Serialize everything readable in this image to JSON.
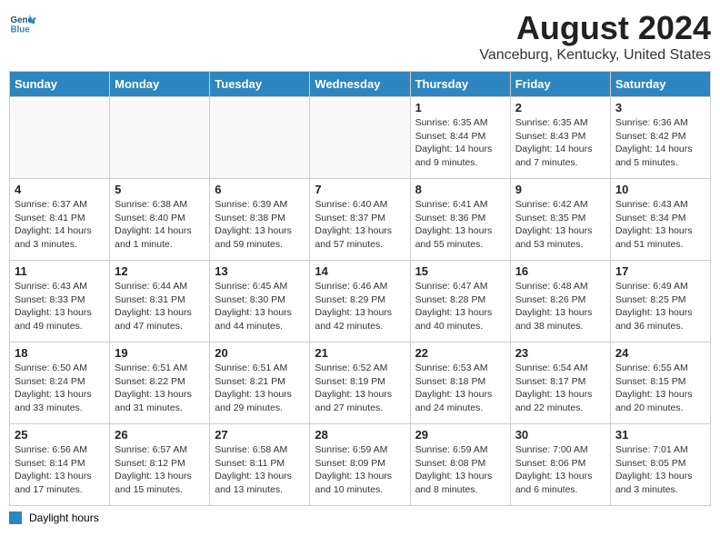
{
  "header": {
    "logo_line1": "General",
    "logo_line2": "Blue",
    "month": "August 2024",
    "location": "Vanceburg, Kentucky, United States"
  },
  "days_of_week": [
    "Sunday",
    "Monday",
    "Tuesday",
    "Wednesday",
    "Thursday",
    "Friday",
    "Saturday"
  ],
  "weeks": [
    [
      {
        "day": "",
        "info": ""
      },
      {
        "day": "",
        "info": ""
      },
      {
        "day": "",
        "info": ""
      },
      {
        "day": "",
        "info": ""
      },
      {
        "day": "1",
        "info": "Sunrise: 6:35 AM\nSunset: 8:44 PM\nDaylight: 14 hours\nand 9 minutes."
      },
      {
        "day": "2",
        "info": "Sunrise: 6:35 AM\nSunset: 8:43 PM\nDaylight: 14 hours\nand 7 minutes."
      },
      {
        "day": "3",
        "info": "Sunrise: 6:36 AM\nSunset: 8:42 PM\nDaylight: 14 hours\nand 5 minutes."
      }
    ],
    [
      {
        "day": "4",
        "info": "Sunrise: 6:37 AM\nSunset: 8:41 PM\nDaylight: 14 hours\nand 3 minutes."
      },
      {
        "day": "5",
        "info": "Sunrise: 6:38 AM\nSunset: 8:40 PM\nDaylight: 14 hours\nand 1 minute."
      },
      {
        "day": "6",
        "info": "Sunrise: 6:39 AM\nSunset: 8:38 PM\nDaylight: 13 hours\nand 59 minutes."
      },
      {
        "day": "7",
        "info": "Sunrise: 6:40 AM\nSunset: 8:37 PM\nDaylight: 13 hours\nand 57 minutes."
      },
      {
        "day": "8",
        "info": "Sunrise: 6:41 AM\nSunset: 8:36 PM\nDaylight: 13 hours\nand 55 minutes."
      },
      {
        "day": "9",
        "info": "Sunrise: 6:42 AM\nSunset: 8:35 PM\nDaylight: 13 hours\nand 53 minutes."
      },
      {
        "day": "10",
        "info": "Sunrise: 6:43 AM\nSunset: 8:34 PM\nDaylight: 13 hours\nand 51 minutes."
      }
    ],
    [
      {
        "day": "11",
        "info": "Sunrise: 6:43 AM\nSunset: 8:33 PM\nDaylight: 13 hours\nand 49 minutes."
      },
      {
        "day": "12",
        "info": "Sunrise: 6:44 AM\nSunset: 8:31 PM\nDaylight: 13 hours\nand 47 minutes."
      },
      {
        "day": "13",
        "info": "Sunrise: 6:45 AM\nSunset: 8:30 PM\nDaylight: 13 hours\nand 44 minutes."
      },
      {
        "day": "14",
        "info": "Sunrise: 6:46 AM\nSunset: 8:29 PM\nDaylight: 13 hours\nand 42 minutes."
      },
      {
        "day": "15",
        "info": "Sunrise: 6:47 AM\nSunset: 8:28 PM\nDaylight: 13 hours\nand 40 minutes."
      },
      {
        "day": "16",
        "info": "Sunrise: 6:48 AM\nSunset: 8:26 PM\nDaylight: 13 hours\nand 38 minutes."
      },
      {
        "day": "17",
        "info": "Sunrise: 6:49 AM\nSunset: 8:25 PM\nDaylight: 13 hours\nand 36 minutes."
      }
    ],
    [
      {
        "day": "18",
        "info": "Sunrise: 6:50 AM\nSunset: 8:24 PM\nDaylight: 13 hours\nand 33 minutes."
      },
      {
        "day": "19",
        "info": "Sunrise: 6:51 AM\nSunset: 8:22 PM\nDaylight: 13 hours\nand 31 minutes."
      },
      {
        "day": "20",
        "info": "Sunrise: 6:51 AM\nSunset: 8:21 PM\nDaylight: 13 hours\nand 29 minutes."
      },
      {
        "day": "21",
        "info": "Sunrise: 6:52 AM\nSunset: 8:19 PM\nDaylight: 13 hours\nand 27 minutes."
      },
      {
        "day": "22",
        "info": "Sunrise: 6:53 AM\nSunset: 8:18 PM\nDaylight: 13 hours\nand 24 minutes."
      },
      {
        "day": "23",
        "info": "Sunrise: 6:54 AM\nSunset: 8:17 PM\nDaylight: 13 hours\nand 22 minutes."
      },
      {
        "day": "24",
        "info": "Sunrise: 6:55 AM\nSunset: 8:15 PM\nDaylight: 13 hours\nand 20 minutes."
      }
    ],
    [
      {
        "day": "25",
        "info": "Sunrise: 6:56 AM\nSunset: 8:14 PM\nDaylight: 13 hours\nand 17 minutes."
      },
      {
        "day": "26",
        "info": "Sunrise: 6:57 AM\nSunset: 8:12 PM\nDaylight: 13 hours\nand 15 minutes."
      },
      {
        "day": "27",
        "info": "Sunrise: 6:58 AM\nSunset: 8:11 PM\nDaylight: 13 hours\nand 13 minutes."
      },
      {
        "day": "28",
        "info": "Sunrise: 6:59 AM\nSunset: 8:09 PM\nDaylight: 13 hours\nand 10 minutes."
      },
      {
        "day": "29",
        "info": "Sunrise: 6:59 AM\nSunset: 8:08 PM\nDaylight: 13 hours\nand 8 minutes."
      },
      {
        "day": "30",
        "info": "Sunrise: 7:00 AM\nSunset: 8:06 PM\nDaylight: 13 hours\nand 6 minutes."
      },
      {
        "day": "31",
        "info": "Sunrise: 7:01 AM\nSunset: 8:05 PM\nDaylight: 13 hours\nand 3 minutes."
      }
    ]
  ],
  "footer": {
    "legend_label": "Daylight hours"
  }
}
